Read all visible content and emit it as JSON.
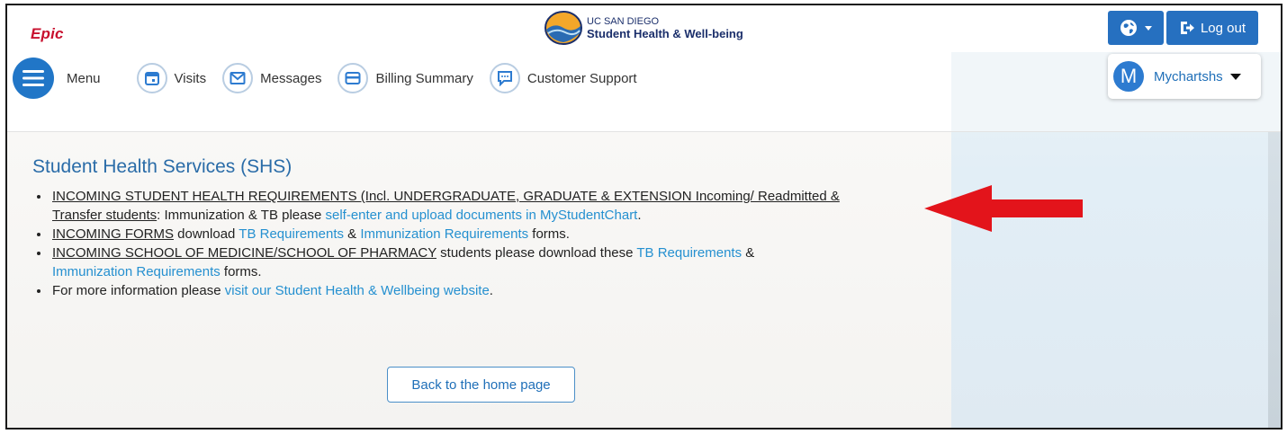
{
  "header": {
    "epic_logo": "Epic",
    "brand_line1": "UC SAN DIEGO",
    "brand_line2": "Student Health & Well-being",
    "logout_label": "Log out"
  },
  "nav": {
    "menu_label": "Menu",
    "visits_label": "Visits",
    "messages_label": "Messages",
    "billing_label": "Billing Summary",
    "support_label": "Customer Support"
  },
  "user": {
    "avatar_initial": "M",
    "name": "Mychartshs"
  },
  "content": {
    "title": "Student Health Services (SHS)",
    "item1_underlined_a": "INCOMING STUDENT HEALTH REQUIREMENTS (Incl. UNDERGRADUATE, GRADUATE & EXTENSION Incoming/ Readmitted &",
    "item1_underlined_b": "Transfer students",
    "item1_text": ": Immunization & TB please ",
    "item1_link": "self-enter and upload documents in MyStudentChart",
    "item1_end": ".",
    "item2_underlined": "INCOMING FORMS",
    "item2_text_a": " download ",
    "item2_link_a": "TB Requirements",
    "item2_text_b": " & ",
    "item2_link_b": "Immunization Requirements",
    "item2_text_c": " forms.",
    "item3_underlined": "INCOMING SCHOOL OF MEDICINE/SCHOOL OF PHARMACY",
    "item3_text_a": " students please download these ",
    "item3_link_a": "TB Requirements",
    "item3_text_b": " &",
    "item3_link_b": "Immunization Requirements",
    "item3_text_c": " forms.",
    "item4_text": "For more information please ",
    "item4_link": "visit our Student Health & Wellbeing website",
    "item4_end": ".",
    "back_button": "Back to the home page"
  },
  "colors": {
    "brand_blue": "#2670c0",
    "link_blue": "#2590d0",
    "title_blue": "#2a6ca8",
    "epic_red": "#c8102e",
    "arrow_red": "#e3141b"
  },
  "icons": [
    "globe-icon",
    "logout-icon",
    "menu-icon",
    "calendar-icon",
    "envelope-icon",
    "credit-card-icon",
    "chat-icon",
    "caret-down-icon",
    "arrow-icon"
  ]
}
